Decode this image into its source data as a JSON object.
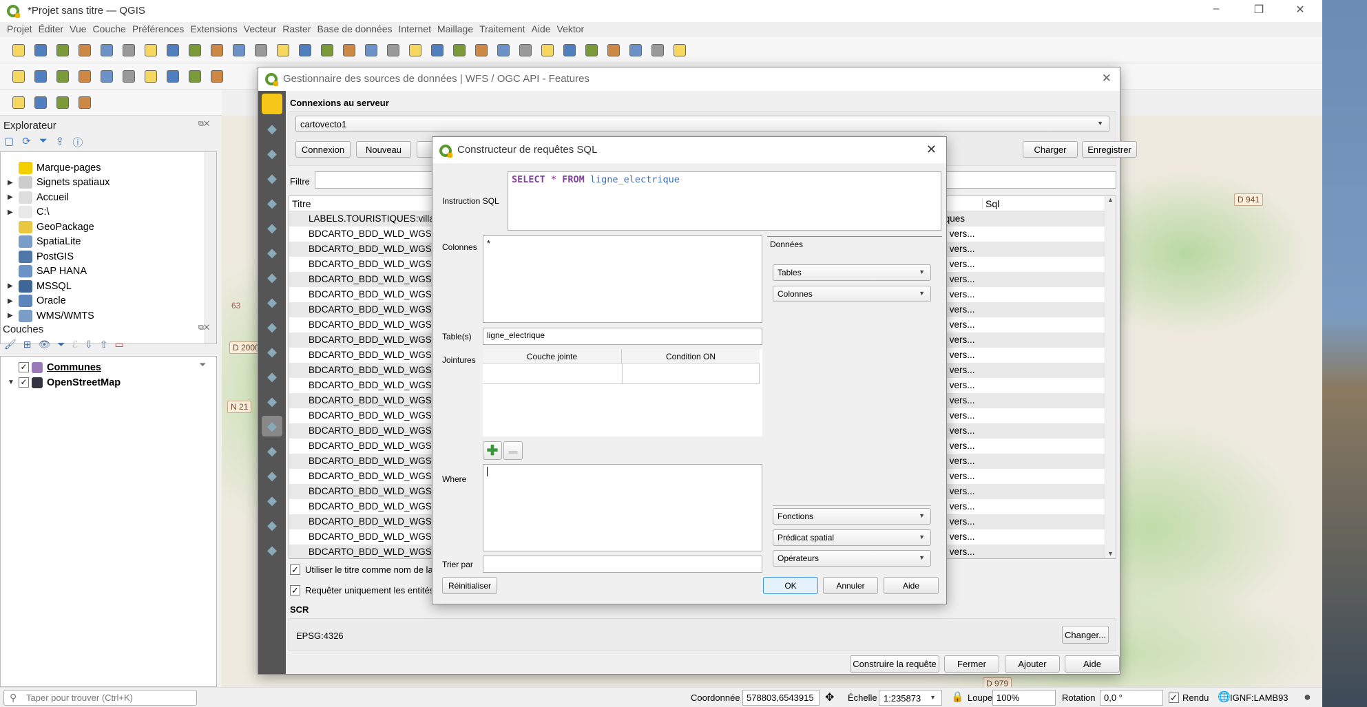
{
  "window": {
    "title": "*Projet sans titre — QGIS",
    "minimize": "–",
    "restore": "❐",
    "close": "✕"
  },
  "menu": [
    "Projet",
    "Éditer",
    "Vue",
    "Couche",
    "Préférences",
    "Extensions",
    "Vecteur",
    "Raster",
    "Base de données",
    "Internet",
    "Maillage",
    "Traitement",
    "Aide",
    "Vektor"
  ],
  "toolbars": {
    "row1": [
      "new-project",
      "open-project",
      "save-project",
      "new-print-layout",
      "layout-manager",
      "style-manager",
      "pan",
      "pan-to-selection",
      "zoom-in",
      "zoom-out",
      "zoom-full",
      "zoom-to-selection",
      "zoom-to-layer",
      "zoom-native",
      "zoom-last",
      "zoom-next",
      "new-map-view",
      "new-3d-view",
      "new-bookmark",
      "show-bookmarks",
      "temporal-controller",
      "refresh",
      "identify",
      "attribute-table",
      "processing",
      "statistics",
      "open-table",
      "measure",
      "map-tips",
      "actions",
      "text-annotation"
    ],
    "row2": [
      "data-source-manager",
      "new-geopackage-layer",
      "new-shapefile-layer",
      "new-spatialite-layer",
      "new-virtual-layer",
      "new-temporary-layer",
      "digitize",
      "toggle-editing",
      "save-edits",
      "add-feature"
    ],
    "row3": [
      "select-features",
      "select-by-value",
      "deselect",
      "select-by-location"
    ]
  },
  "explorer": {
    "title": "Explorateur",
    "items": [
      {
        "label": "Marque-pages",
        "icon": "star-icon",
        "color": "#f5d000",
        "expand": false
      },
      {
        "label": "Signets spatiaux",
        "icon": "bookmark-icon",
        "color": "#ccc",
        "expand": true
      },
      {
        "label": "Accueil",
        "icon": "home-icon",
        "color": "#ddd",
        "expand": true
      },
      {
        "label": "C:\\",
        "icon": "folder-icon",
        "color": "#e8e8e8",
        "expand": true
      },
      {
        "label": "GeoPackage",
        "icon": "geopackage-icon",
        "color": "#e8c840",
        "expand": false
      },
      {
        "label": "SpatiaLite",
        "icon": "feather-icon",
        "color": "#7a9cc8",
        "expand": false
      },
      {
        "label": "PostGIS",
        "icon": "elephant-icon",
        "color": "#4f77a8",
        "expand": false
      },
      {
        "label": "SAP HANA",
        "icon": "hana-icon",
        "color": "#6b93c8",
        "expand": false
      },
      {
        "label": "MSSQL",
        "icon": "mssql-icon",
        "color": "#3e6696",
        "expand": true
      },
      {
        "label": "Oracle",
        "icon": "oracle-icon",
        "color": "#5b85bb",
        "expand": true
      },
      {
        "label": "WMS/WMTS",
        "icon": "globe-icon",
        "color": "#7b9ec8",
        "expand": true
      }
    ]
  },
  "layers": {
    "title": "Couches",
    "items": [
      {
        "label": "Communes",
        "color": "#9b78b8",
        "checked": true,
        "icon": "polygon-symbol-icon"
      },
      {
        "label": "OpenStreetMap",
        "color": "#334",
        "checked": true,
        "icon": "raster-icon"
      }
    ]
  },
  "map_labels": [
    "63",
    "D 2000",
    "N 21",
    "D 941",
    "D 979"
  ],
  "dsm": {
    "title": "Gestionnaire des sources de données | WFS / OGC API - Features",
    "connections_heading": "Connexions au serveur",
    "connection": "cartovecto1",
    "buttons": {
      "connect": "Connexion",
      "new": "Nouveau",
      "load": "Charger",
      "save": "Enregistrer"
    },
    "filter_label": "Filtre",
    "filter_value": "",
    "columns": {
      "title": "Titre",
      "sql": "Sql"
    },
    "rows": [
      {
        "title": "LABELS.TOURISTIQUES:villa",
        "sql": "tiques"
      },
      {
        "title": "BDCARTO_BDD_WLD_WGS",
        "sql": "® vers..."
      },
      {
        "title": "BDCARTO_BDD_WLD_WGS",
        "sql": "® vers..."
      },
      {
        "title": "BDCARTO_BDD_WLD_WGS",
        "sql": "® vers..."
      },
      {
        "title": "BDCARTO_BDD_WLD_WGS",
        "sql": "® vers..."
      },
      {
        "title": "BDCARTO_BDD_WLD_WGS",
        "sql": "® vers..."
      },
      {
        "title": "BDCARTO_BDD_WLD_WGS",
        "sql": "® vers..."
      },
      {
        "title": "BDCARTO_BDD_WLD_WGS",
        "sql": "® vers..."
      },
      {
        "title": "BDCARTO_BDD_WLD_WGS",
        "sql": "® vers..."
      },
      {
        "title": "BDCARTO_BDD_WLD_WGS",
        "sql": "® vers..."
      },
      {
        "title": "BDCARTO_BDD_WLD_WGS",
        "sql": "® vers..."
      },
      {
        "title": "BDCARTO_BDD_WLD_WGS",
        "sql": "® vers..."
      },
      {
        "title": "BDCARTO_BDD_WLD_WGS",
        "sql": "® vers..."
      },
      {
        "title": "BDCARTO_BDD_WLD_WGS",
        "sql": "® vers..."
      },
      {
        "title": "BDCARTO_BDD_WLD_WGS",
        "sql": "® vers..."
      },
      {
        "title": "BDCARTO_BDD_WLD_WGS",
        "sql": "® vers..."
      },
      {
        "title": "BDCARTO_BDD_WLD_WGS",
        "sql": "® vers..."
      },
      {
        "title": "BDCARTO_BDD_WLD_WGS",
        "sql": "® vers..."
      },
      {
        "title": "BDCARTO_BDD_WLD_WGS",
        "sql": "® vers..."
      },
      {
        "title": "BDCARTO_BDD_WLD_WGS",
        "sql": "® vers..."
      },
      {
        "title": "BDCARTO_BDD_WLD_WGS",
        "sql": "® vers..."
      },
      {
        "title": "BDCARTO_BDD_WLD_WGS",
        "sql": "® vers..."
      },
      {
        "title": "BDCARTO_BDD_WLD_WGS",
        "sql": "® vers..."
      }
    ],
    "use_title_label": "Utiliser le titre comme nom de la",
    "use_title_checked": true,
    "only_extent_label": "Requêter uniquement les entités",
    "only_extent_checked": true,
    "crs_heading": "SCR",
    "crs_value": "EPSG:4326",
    "change": "Changer...",
    "footer": {
      "build": "Construire la requête",
      "close": "Fermer",
      "add": "Ajouter",
      "help": "Aide"
    },
    "sidebar_icons": [
      "folder-icon",
      "vector-icon",
      "raster-icon",
      "mesh-icon",
      "point-cloud-icon",
      "delimited-text-icon",
      "geopackage-icon",
      "spatialite-icon",
      "postgis-icon",
      "mssql-icon",
      "oracle-icon",
      "virtual-layer-icon",
      "hana-icon",
      "wms-icon",
      "wfs-icon",
      "wcs-icon",
      "xyz-icon",
      "arcgis-icon",
      "vector-tile-icon"
    ]
  },
  "qb": {
    "title": "Constructeur de requêtes SQL",
    "sql_label": "Instruction SQL",
    "sql": {
      "select": "SELECT",
      "star": "*",
      "from": "FROM",
      "table": "ligne_electrique"
    },
    "columns_label": "Colonnes",
    "columns_value": "*",
    "tables_label": "Table(s)",
    "tables_value": "ligne_electrique",
    "joins_label": "Jointures",
    "join_cols": [
      "Couche jointe",
      "Condition ON"
    ],
    "where_label": "Where",
    "where_value": "",
    "order_label": "Trier par",
    "order_value": "",
    "data_tab": "Données",
    "combos": {
      "tables": "Tables",
      "columns": "Colonnes",
      "functions": "Fonctions",
      "spatial": "Prédicat spatial",
      "operators": "Opérateurs"
    },
    "buttons": {
      "reset": "Réinitialiser",
      "ok": "OK",
      "cancel": "Annuler",
      "help": "Aide"
    }
  },
  "status": {
    "search_placeholder": "Taper pour trouver (Ctrl+K)",
    "coord_label": "Coordonnée",
    "coord": "578803,6543915",
    "scale_label": "Échelle",
    "scale": "1:235873",
    "magnifier_label": "Loupe",
    "magnifier": "100%",
    "rotation_label": "Rotation",
    "rotation": "0,0 °",
    "render_label": "Rendu",
    "render_checked": true,
    "crs": "IGNF:LAMB93"
  }
}
